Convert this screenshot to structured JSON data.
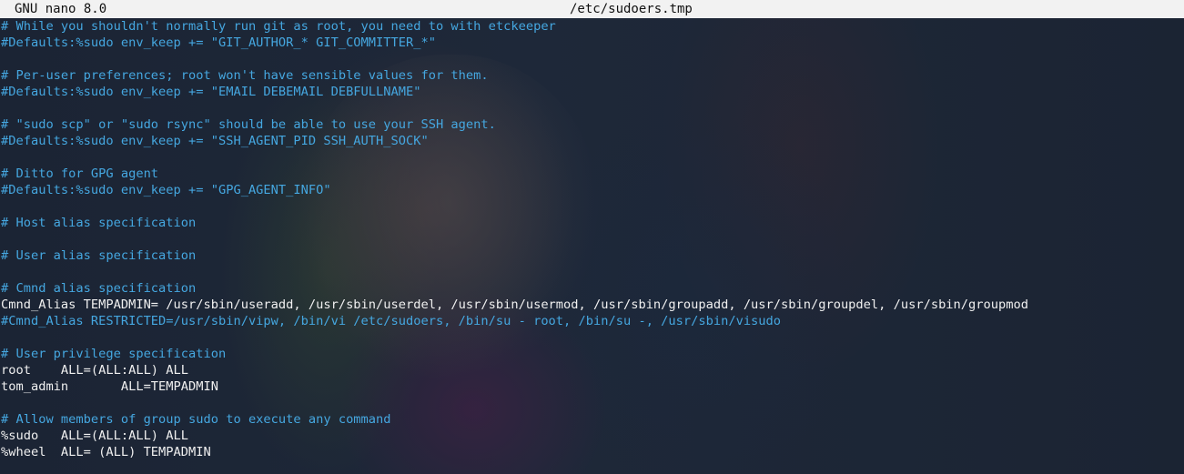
{
  "title_bar": {
    "app_name": "GNU nano 8.0",
    "file_name": "/etc/sudoers.tmp"
  },
  "colors": {
    "comment": "#45a7e0",
    "code": "#f0f0f0",
    "title_bar_bg": "#f2f2f2"
  },
  "lines": [
    {
      "text": "# While you shouldn't normally run git as root, you need to with etckeeper",
      "kind": "comment"
    },
    {
      "text": "#Defaults:%sudo env_keep += \"GIT_AUTHOR_* GIT_COMMITTER_*\"",
      "kind": "comment"
    },
    {
      "text": "",
      "kind": "blank"
    },
    {
      "text": "# Per-user preferences; root won't have sensible values for them.",
      "kind": "comment"
    },
    {
      "text": "#Defaults:%sudo env_keep += \"EMAIL DEBEMAIL DEBFULLNAME\"",
      "kind": "comment"
    },
    {
      "text": "",
      "kind": "blank"
    },
    {
      "text": "# \"sudo scp\" or \"sudo rsync\" should be able to use your SSH agent.",
      "kind": "comment"
    },
    {
      "text": "#Defaults:%sudo env_keep += \"SSH_AGENT_PID SSH_AUTH_SOCK\"",
      "kind": "comment"
    },
    {
      "text": "",
      "kind": "blank"
    },
    {
      "text": "# Ditto for GPG agent",
      "kind": "comment"
    },
    {
      "text": "#Defaults:%sudo env_keep += \"GPG_AGENT_INFO\"",
      "kind": "comment"
    },
    {
      "text": "",
      "kind": "blank"
    },
    {
      "text": "# Host alias specification",
      "kind": "comment"
    },
    {
      "text": "",
      "kind": "blank"
    },
    {
      "text": "# User alias specification",
      "kind": "comment"
    },
    {
      "text": "",
      "kind": "blank"
    },
    {
      "text": "# Cmnd alias specification",
      "kind": "comment"
    },
    {
      "text": "Cmnd_Alias TEMPADMIN= /usr/sbin/useradd, /usr/sbin/userdel, /usr/sbin/usermod, /usr/sbin/groupadd, /usr/sbin/groupdel, /usr/sbin/groupmod",
      "kind": "code"
    },
    {
      "text": "#Cmnd_Alias RESTRICTED=/usr/sbin/vipw, /bin/vi /etc/sudoers, /bin/su - root, /bin/su -, /usr/sbin/visudo",
      "kind": "comment"
    },
    {
      "text": "",
      "kind": "blank"
    },
    {
      "text": "# User privilege specification",
      "kind": "comment"
    },
    {
      "text": "root    ALL=(ALL:ALL) ALL",
      "kind": "code"
    },
    {
      "text": "tom_admin       ALL=TEMPADMIN",
      "kind": "code"
    },
    {
      "text": "",
      "kind": "blank"
    },
    {
      "text": "# Allow members of group sudo to execute any command",
      "kind": "comment"
    },
    {
      "text": "%sudo   ALL=(ALL:ALL) ALL",
      "kind": "code"
    },
    {
      "text": "%wheel  ALL= (ALL) TEMPADMIN",
      "kind": "code"
    }
  ]
}
